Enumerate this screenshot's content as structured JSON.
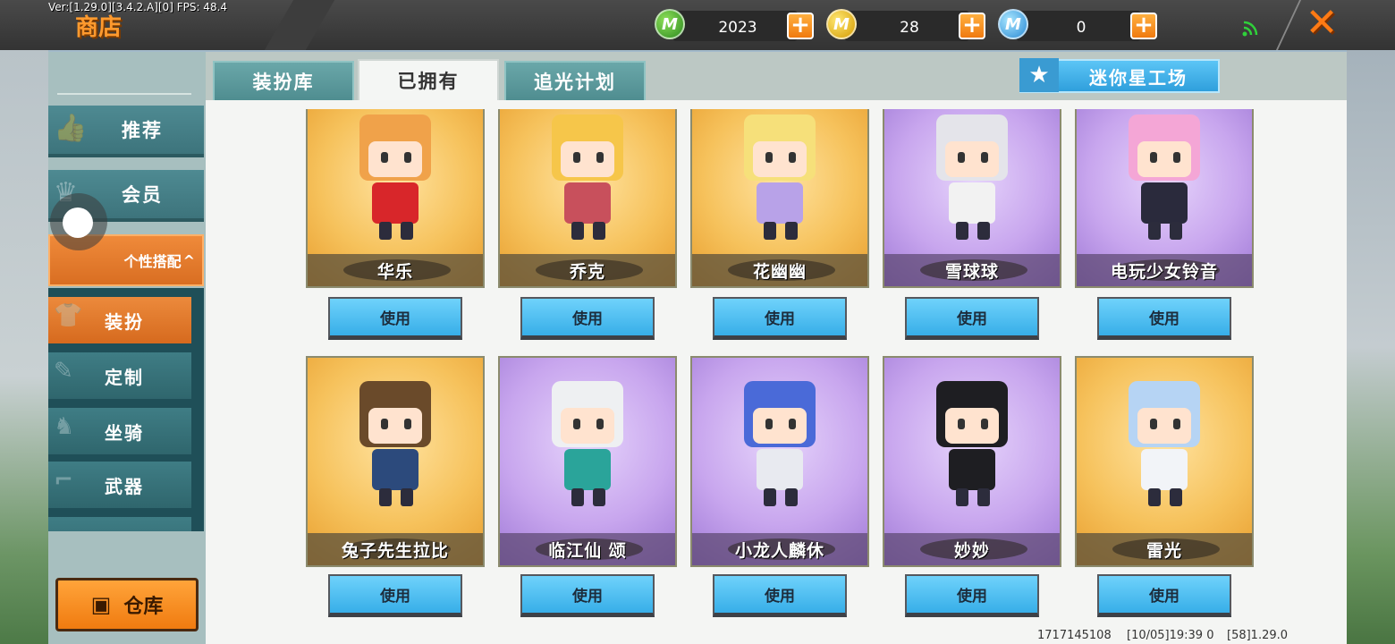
{
  "topbar": {
    "version": "Ver:[1.29.0][3.4.2.A][0] FPS: 48.4",
    "title": "商店",
    "currencies": [
      {
        "icon": "mini-bean-green-coin-icon",
        "glyph": "M",
        "value": "2023"
      },
      {
        "icon": "mini-coin-gold-icon",
        "glyph": "M",
        "value": "28"
      },
      {
        "icon": "mini-point-blue-coin-icon",
        "glyph": "M",
        "value": "0"
      }
    ],
    "plus": "+",
    "close": "✕"
  },
  "tabs": [
    {
      "label": "装扮库",
      "active": false
    },
    {
      "label": "已拥有",
      "active": true
    },
    {
      "label": "追光计划",
      "active": false
    }
  ],
  "workshop": {
    "label": "迷你星工场",
    "star": "★"
  },
  "sidebar": {
    "items": [
      {
        "label": "推荐",
        "icon": "thumbs-up-icon",
        "glyph": "👍"
      },
      {
        "label": "会员",
        "icon": "member-icon",
        "glyph": "♛"
      }
    ],
    "group": {
      "label": "个性搭配",
      "arrow": "^"
    },
    "sub_items": [
      {
        "label": "装扮",
        "icon": "shirt-icon",
        "glyph": "👕",
        "active": true
      },
      {
        "label": "定制",
        "icon": "pencil-icon",
        "glyph": "✎",
        "active": false
      },
      {
        "label": "坐骑",
        "icon": "saddle-icon",
        "glyph": "♞",
        "active": false
      },
      {
        "label": "武器",
        "icon": "gun-icon",
        "glyph": "⌐",
        "active": false
      }
    ],
    "warehouse": {
      "label": "仓库",
      "glyph": "▣"
    }
  },
  "skins": [
    {
      "name": "华乐",
      "theme": "gold",
      "hair": "#f0a24a",
      "outfit": "#d8262a"
    },
    {
      "name": "乔克",
      "theme": "gold",
      "hair": "#f6c64a",
      "outfit": "#c8505c"
    },
    {
      "name": "花幽幽",
      "theme": "gold",
      "hair": "#f6e07a",
      "outfit": "#b8a2e8"
    },
    {
      "name": "雪球球",
      "theme": "purple",
      "hair": "#e4e4ea",
      "outfit": "#f2f2f2"
    },
    {
      "name": "电玩少女铃音",
      "theme": "purple",
      "hair": "#f4a6d6",
      "outfit": "#2a2a3c"
    },
    {
      "name": "兔子先生拉比",
      "theme": "gold",
      "hair": "#6a4a2a",
      "outfit": "#2c4a7c"
    },
    {
      "name": "临江仙 颂",
      "theme": "purple",
      "hair": "#eef0f2",
      "outfit": "#2aa49a"
    },
    {
      "name": "小龙人麟休",
      "theme": "purple",
      "hair": "#4a6ad8",
      "outfit": "#e8eaf0"
    },
    {
      "name": "妙妙",
      "theme": "purple",
      "hair": "#1e1e22",
      "outfit": "#1e1e22"
    },
    {
      "name": "雷光",
      "theme": "gold",
      "hair": "#b6d4f4",
      "outfit": "#f2f4f8"
    }
  ],
  "use_label": "使用",
  "footer": {
    "id": "1717145108",
    "time": "[10/05]19:39 0",
    "build": "[58]1.29.0"
  }
}
